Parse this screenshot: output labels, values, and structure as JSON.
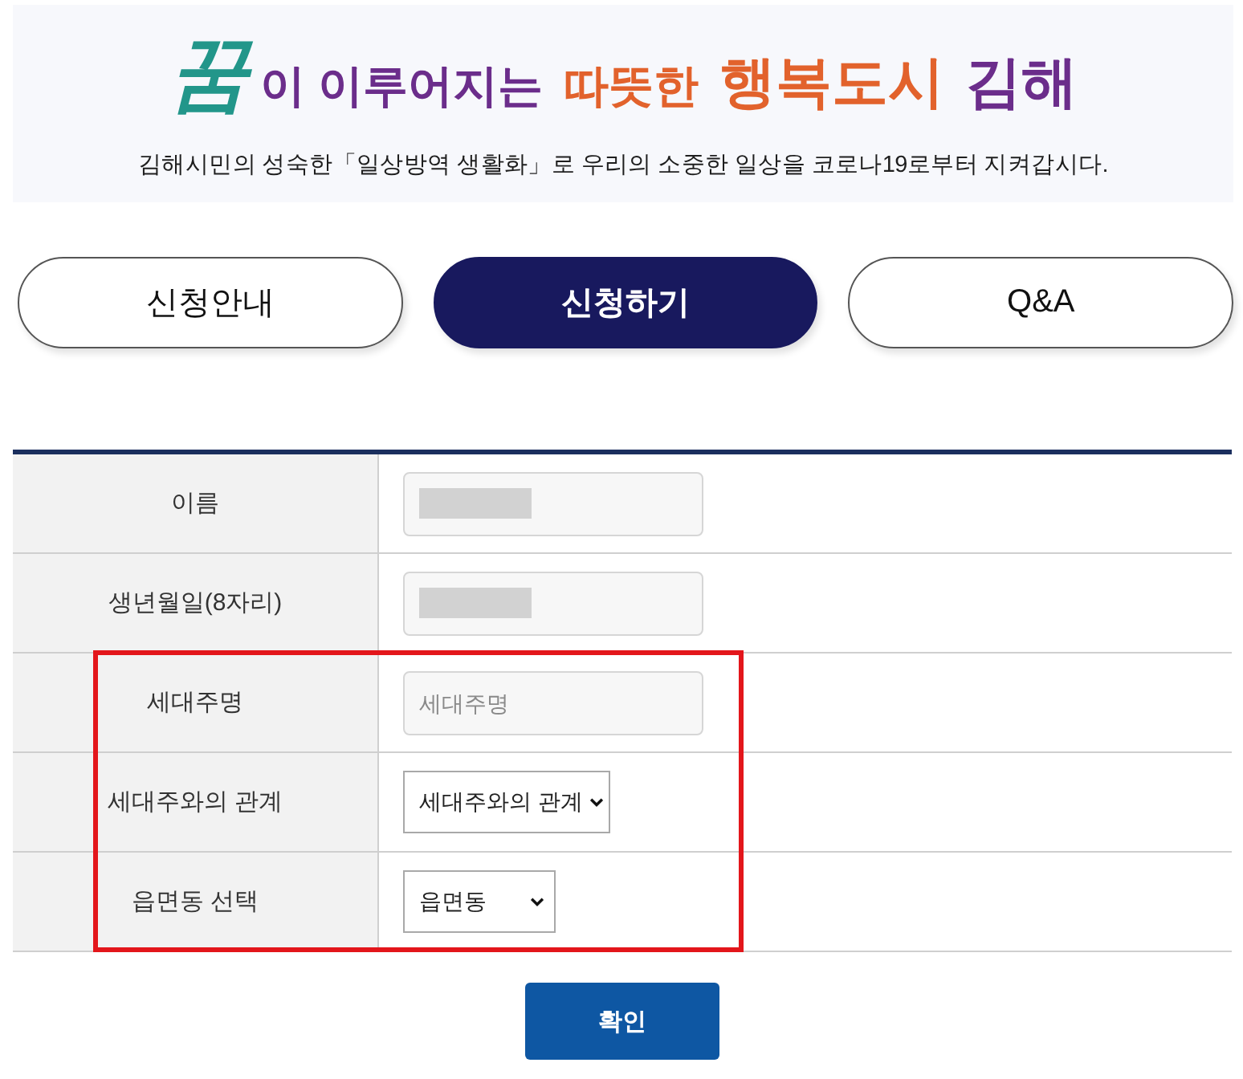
{
  "banner": {
    "slogan": [
      {
        "text": "꿈",
        "kind": "calligraphy",
        "color": "#22968a"
      },
      {
        "text": "이 이루어지는",
        "kind": "normal",
        "color": "#6b2d8b"
      },
      {
        "text": "따뜻한",
        "kind": "normal",
        "color": "#e2622c"
      },
      {
        "text": "행복도시",
        "kind": "large",
        "color": "#e2622c"
      },
      {
        "text": "김해",
        "kind": "large",
        "color": "#6b2d8b"
      }
    ],
    "subtitle": "김해시민의 성숙한「일상방역 생활화」로 우리의 소중한 일상을 코로나19로부터 지켜갑시다."
  },
  "tabs": [
    {
      "label": "신청안내",
      "selected": false
    },
    {
      "label": "신청하기",
      "selected": true
    },
    {
      "label": "Q&A",
      "selected": false
    }
  ],
  "form": {
    "rows": [
      {
        "label": "이름",
        "highlighted": false,
        "field": {
          "kind": "text",
          "redacted": true
        }
      },
      {
        "label": "생년월일(8자리)",
        "highlighted": false,
        "field": {
          "kind": "text",
          "redacted": true
        }
      },
      {
        "label": "세대주명",
        "highlighted": true,
        "field": {
          "kind": "text",
          "placeholder": "세대주명"
        }
      },
      {
        "label": "세대주와의 관계",
        "highlighted": true,
        "field": {
          "kind": "select",
          "value": "세대주와의 관계"
        }
      },
      {
        "label": "읍면동 선택",
        "highlighted": true,
        "field": {
          "kind": "select",
          "value": "읍면동"
        }
      }
    ]
  },
  "submit_button": {
    "label": "확인"
  }
}
